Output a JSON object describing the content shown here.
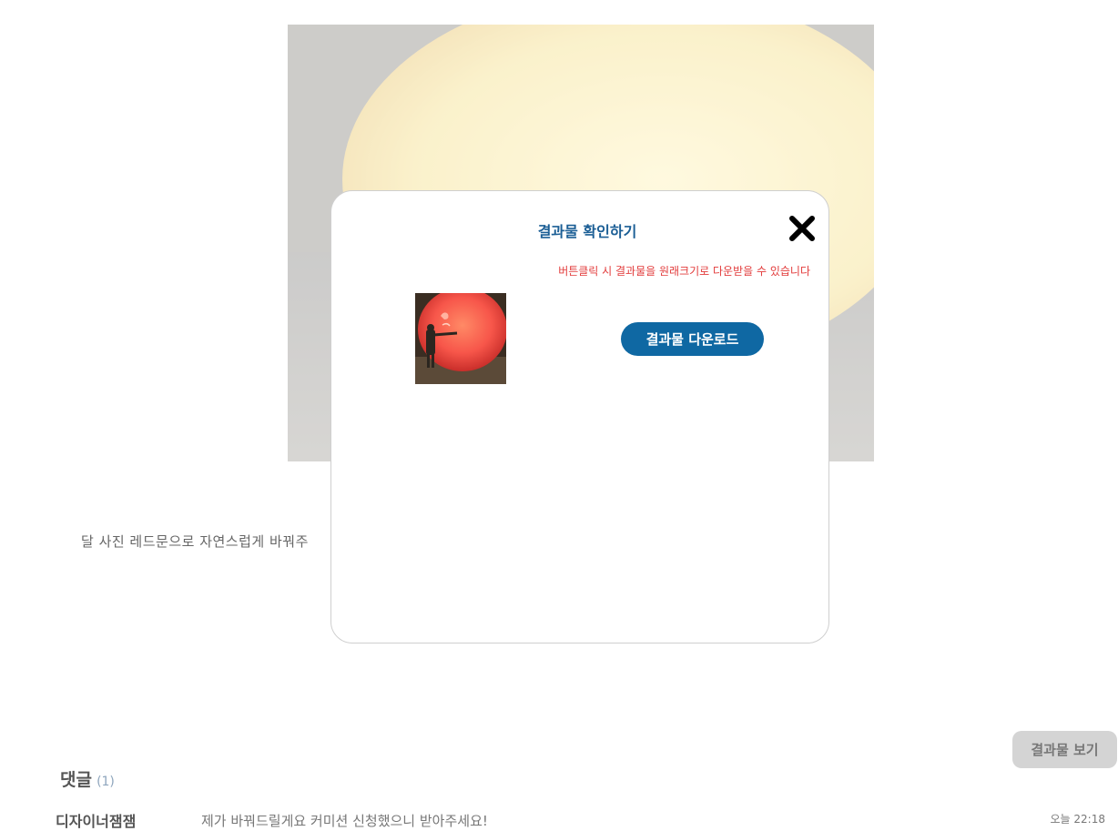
{
  "post": {
    "text": "달 사진 레드문으로 자연스럽게 바꿔주"
  },
  "view_result_button": "결과물 보기",
  "comments": {
    "title": "댓글",
    "count": "(1)",
    "items": [
      {
        "author": "디자이너잼잼",
        "text": "제가 바꿔드릴게요 커미션 신청했으니 받아주세요!",
        "time": "오늘 22:18"
      }
    ]
  },
  "modal": {
    "title": "결과물 확인하기",
    "notice": "버튼클릭 시 결과물을 원래크기로 다운받을 수 있습니다",
    "download_label": "결과물 다운로드",
    "close_icon": "close-x-icon"
  },
  "colors": {
    "modal_title": "#1b5e95",
    "notice": "#e23b3b",
    "download_button": "#0f68a3",
    "view_result_button": "#d4d4d4",
    "comment_count": "#8fa6bd"
  }
}
